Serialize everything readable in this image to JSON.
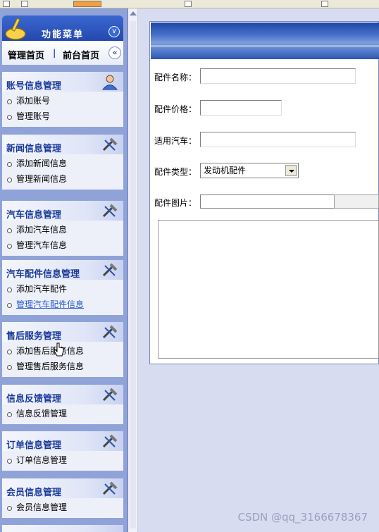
{
  "sidebar": {
    "menu_title": "功能菜单",
    "nav": {
      "admin_home": "管理首页",
      "separator": "|",
      "front_home": "前台首页"
    },
    "groups": [
      {
        "title": "账号信息管理",
        "icon": "user-icon",
        "items": [
          {
            "label": "添加账号"
          },
          {
            "label": "管理账号"
          }
        ]
      },
      {
        "title": "新闻信息管理",
        "icon": "tools-icon",
        "items": [
          {
            "label": "添加新闻信息"
          },
          {
            "label": "管理新闻信息"
          }
        ]
      },
      {
        "title": "汽车信息管理",
        "icon": "tools-icon",
        "items": [
          {
            "label": "添加汽车信息"
          },
          {
            "label": "管理汽车信息"
          }
        ]
      },
      {
        "title": "汽车配件信息管理",
        "icon": "tools-icon",
        "items": [
          {
            "label": "添加汽车配件"
          },
          {
            "label": "管理汽车配件信息"
          }
        ]
      },
      {
        "title": "售后服务管理",
        "icon": "tools-icon",
        "items": [
          {
            "label": "添加售后服务信息"
          },
          {
            "label": "管理售后服务信息"
          }
        ]
      },
      {
        "title": "信息反馈管理",
        "icon": "tools-icon",
        "items": [
          {
            "label": "信息反馈管理"
          }
        ]
      },
      {
        "title": "订单信息管理",
        "icon": "tools-icon",
        "items": [
          {
            "label": "订单信息管理"
          }
        ]
      },
      {
        "title": "会员信息管理",
        "icon": "tools-icon",
        "items": [
          {
            "label": "会员信息管理"
          }
        ]
      }
    ]
  },
  "form": {
    "name_label": "配件名称：",
    "name_value": "",
    "price_label": "配件价格：",
    "price_value": "",
    "car_label": "适用汽车：",
    "car_value": "",
    "type_label": "配件类型：",
    "type_selected": "发动机配件",
    "image_label": "配件图片：",
    "image_value": ""
  },
  "watermark": "CSDN @qq_3166678367"
}
